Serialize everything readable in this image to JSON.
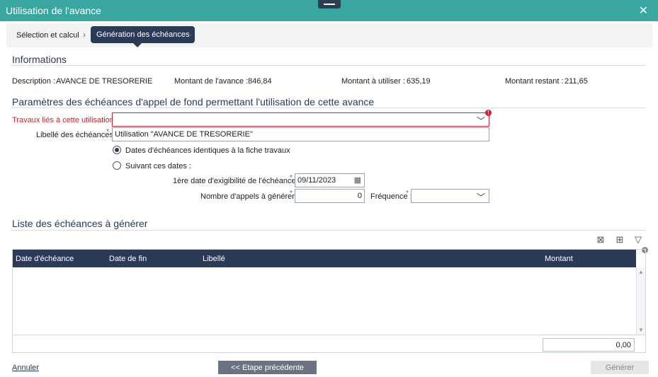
{
  "window": {
    "title": "Utilisation de l'avance"
  },
  "steps": [
    {
      "label": "Sélection et calcul"
    },
    {
      "label": "Génération des échéances"
    }
  ],
  "informations": {
    "title": "Informations",
    "description_label": "Description :",
    "description_value": "AVANCE DE TRESORERIE",
    "montant_avance_label": "Montant de l'avance :",
    "montant_avance_value": "846,84",
    "montant_utiliser_label": "Montant à utiliser :",
    "montant_utiliser_value": "635,19",
    "montant_restant_label": "Montant restant :",
    "montant_restant_value": "211,65"
  },
  "parametres": {
    "title": "Paramètres des échéances d'appel de fond permettant l'utilisation de cette avance",
    "travaux_label": "Travaux liés à cette utilisation :",
    "travaux_value": "",
    "libelle_label": "Libellé des échéances :",
    "libelle_value": "Utilisation \"AVANCE DE TRESORERIE\"",
    "radio_identiques": "Dates d'échéances identiques à la fiche travaux",
    "radio_identiques_checked": true,
    "radio_suivant": "Suivant ces dates :",
    "radio_suivant_checked": false,
    "date_label": "1ère date d'exigibilité de l'échéance :",
    "date_value": "09/11/2023",
    "nb_appels_label": "Nombre d'appels à générer :",
    "nb_appels_value": "0",
    "frequence_label": "Fréquence :",
    "frequence_value": ""
  },
  "liste": {
    "title": "Liste des échéances à générer",
    "columns": [
      "Date d'échéance",
      "Date de fin",
      "Libellé",
      "Montant"
    ],
    "rows": [],
    "total": "0,00"
  },
  "footer": {
    "annuler": "Annuler",
    "etape_precedente": "<< Etape précédente",
    "generer": "Générer"
  }
}
